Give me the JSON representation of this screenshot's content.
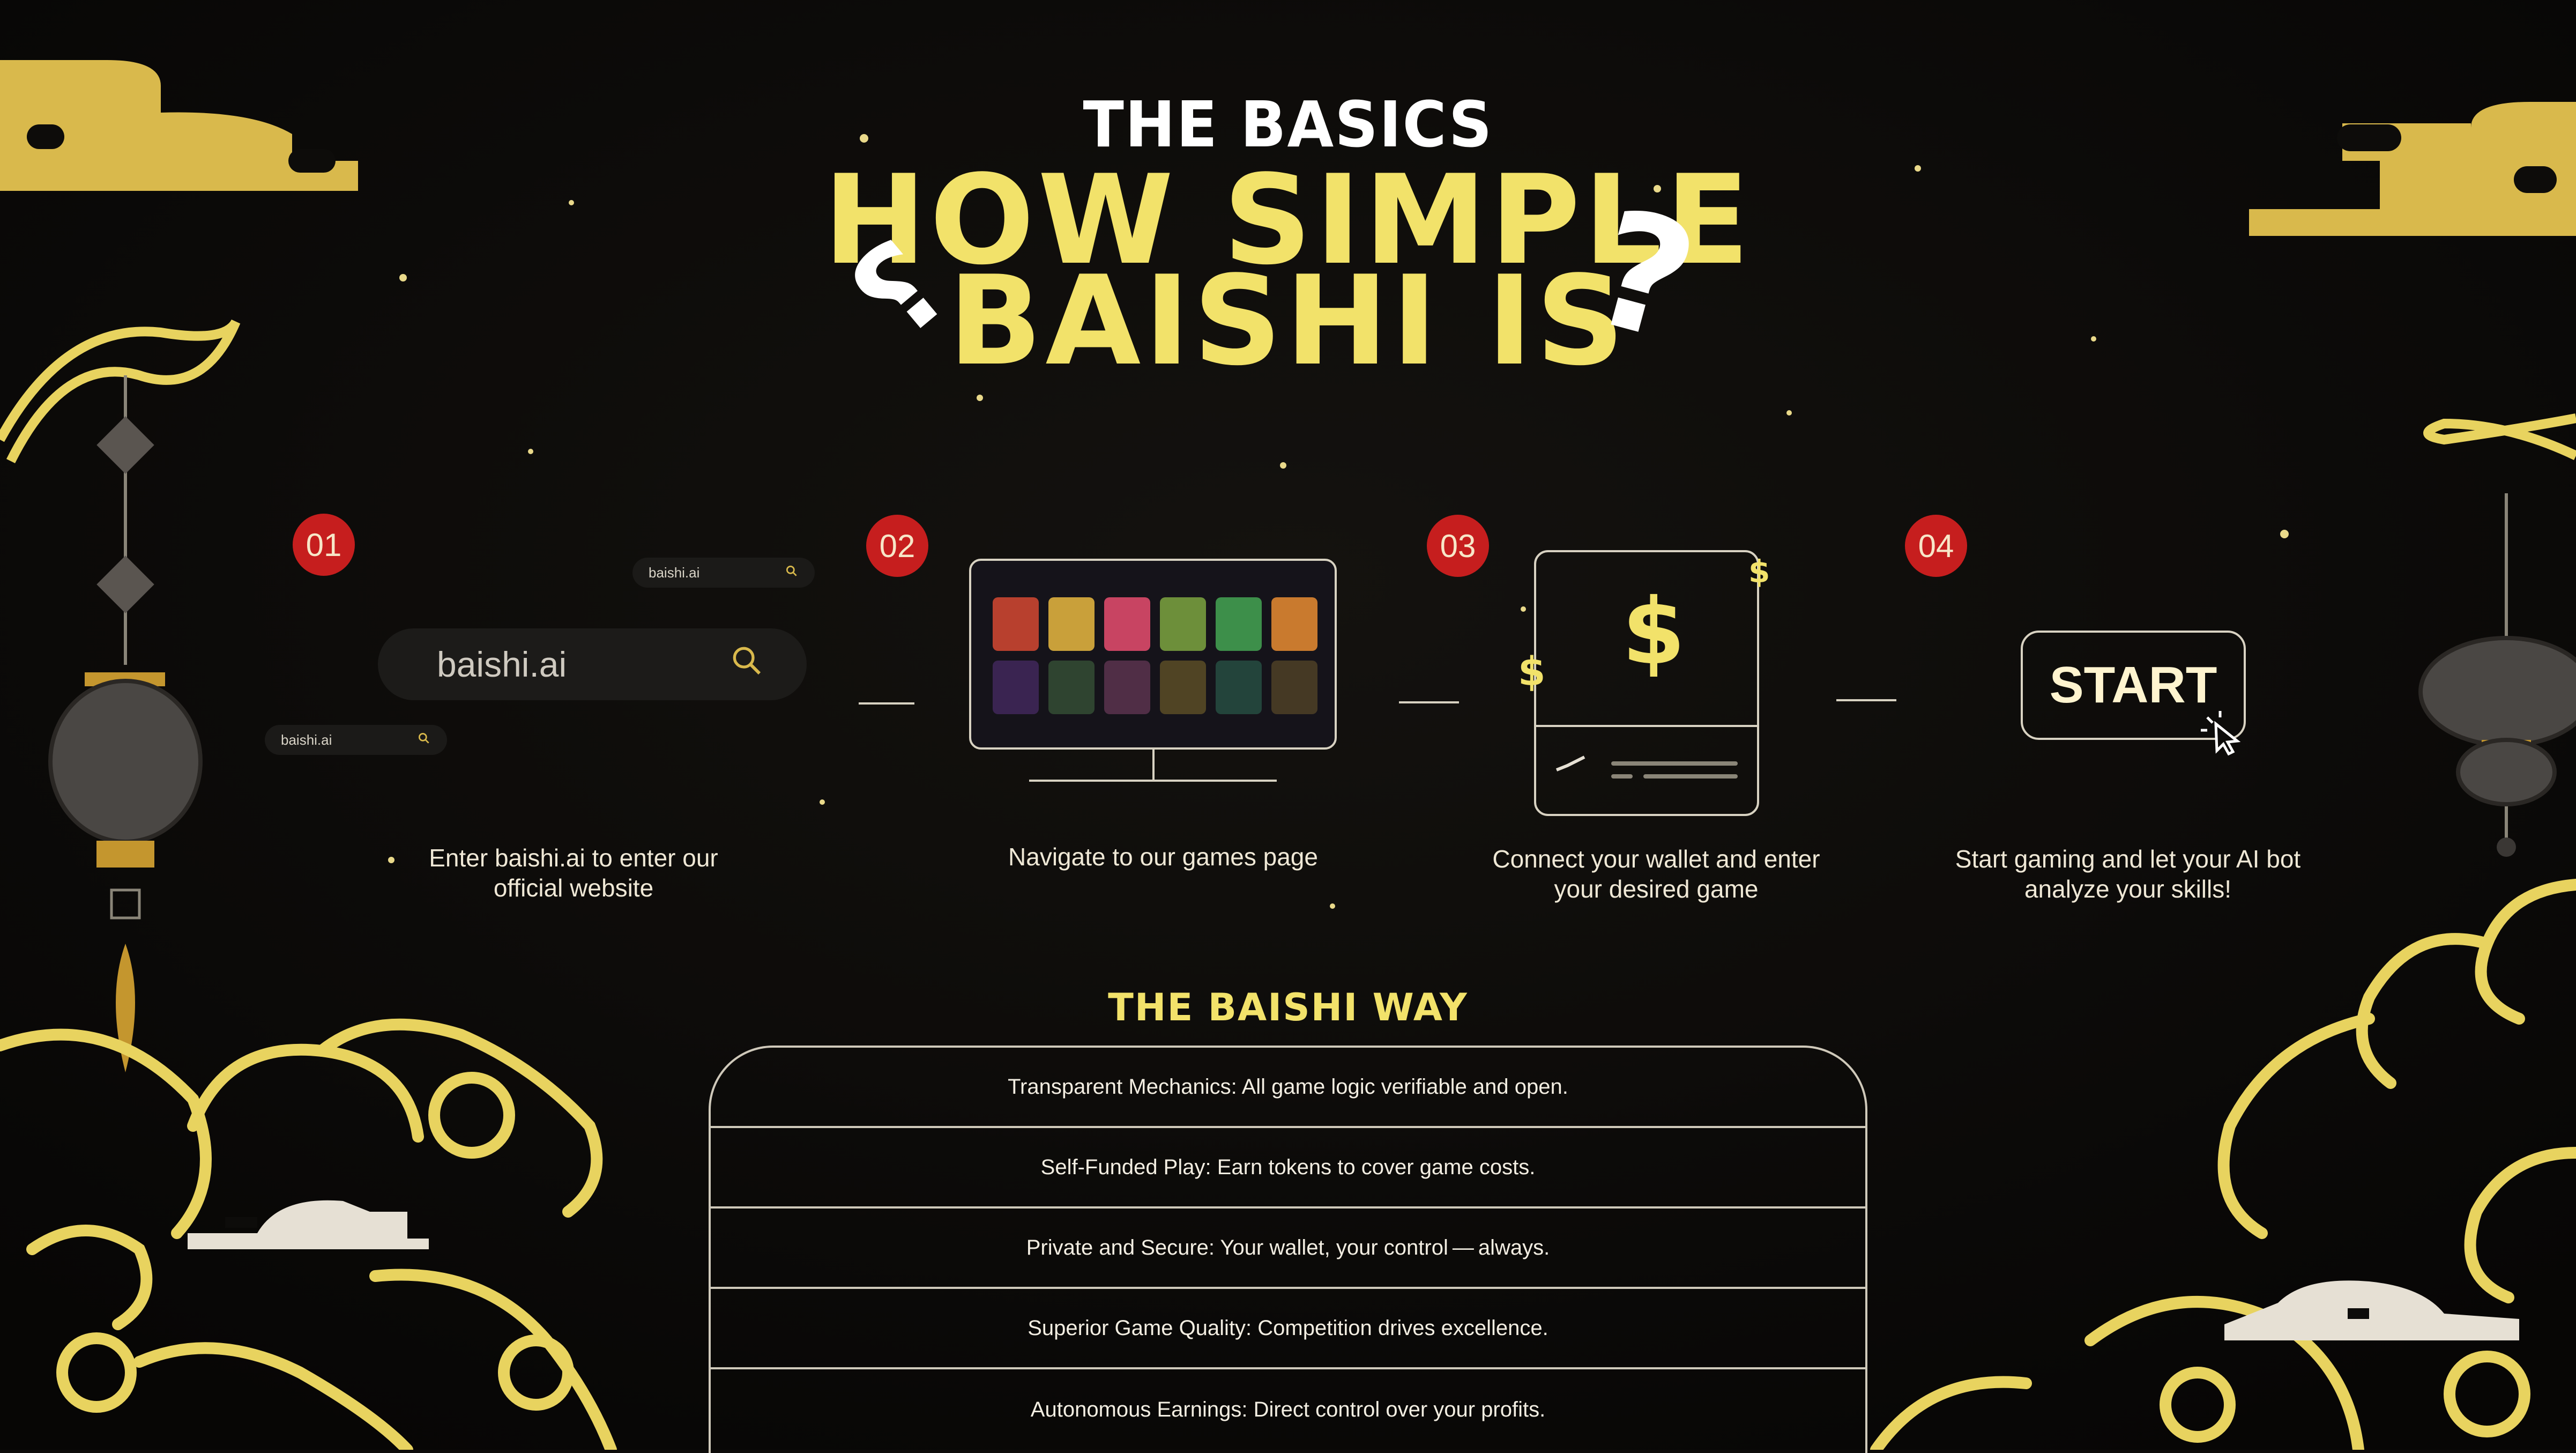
{
  "header": {
    "kicker": "THE BASICS",
    "title_line1": "HOW SIMPLE",
    "title_line2": "BAISHI IS"
  },
  "colors": {
    "accent_gold": "#f2e26a",
    "badge_red": "#c61e1e",
    "background": "#0d0c0a"
  },
  "steps": [
    {
      "number": "01",
      "caption_line1": "Enter baishi.ai to enter our",
      "caption_line2": "official website",
      "search_value": "baishi.ai",
      "mini_search_top": "baishi.ai",
      "mini_search_bottom": "baishi.ai"
    },
    {
      "number": "02",
      "caption_line1": "Navigate to our games page"
    },
    {
      "number": "03",
      "caption_line1": "Connect your wallet and enter",
      "caption_line2": "your desired game",
      "currency_symbol": "$"
    },
    {
      "number": "04",
      "caption_line1": "Start gaming and let your AI bot",
      "caption_line2": "analyze your skills!",
      "button_label": "START"
    }
  ],
  "baishi_way": {
    "title": "THE BAISHI WAY",
    "rows": [
      "Transparent Mechanics: All game logic verifiable and open.",
      "Self-Funded Play: Earn tokens to cover game costs.",
      "Private and Secure: Your wallet, your control — always.",
      "Superior Game Quality: Competition drives excellence.",
      "Autonomous Earnings: Direct control over your profits."
    ]
  },
  "icons": [
    "search-icon",
    "cursor-icon",
    "dollar-icon",
    "lantern-icon",
    "cloud-icon",
    "question-mark-icon"
  ]
}
